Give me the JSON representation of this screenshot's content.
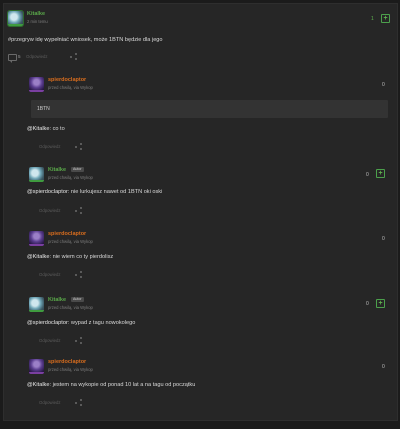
{
  "colors": {
    "background": "#1b1b1b",
    "card": "#262626",
    "op_name": "#5aa84a",
    "other_name": "#d86d1e",
    "plus_accent": "#4ca04c"
  },
  "post": {
    "author": "Kitalke",
    "meta": "2 min temu",
    "score": "1",
    "body": "#przegryw idę wypełniać wniosek, może 1BTN będzie dla jego",
    "comments_count": "5",
    "action_label": "Odpowiedz",
    "icons": [
      "comment-bubble-icon",
      "share-icon",
      "plus-icon"
    ]
  },
  "comments": [
    {
      "author": "spierdoclaptor",
      "meta": "przed chwilą, via Wykop",
      "score": "0",
      "embed": "1BTN",
      "text_mention": "@Kitalke",
      "text_rest": ": co to",
      "action_label": "Odpowiedz"
    },
    {
      "author": "Kitalke",
      "badge": "Autor",
      "meta": "przed chwilą, via Wykop",
      "score": "0",
      "text_mention": "@spierdoclaptor",
      "text_rest": ": nie lurkujesz nawet od 1BTN oki oski",
      "action_label": "Odpowiedz"
    },
    {
      "author": "spierdoclaptor",
      "meta": "przed chwilą, via Wykop",
      "score": "0",
      "text_mention": "@Kitalke",
      "text_rest": ": nie wiem co ty pierdolisz",
      "action_label": "Odpowiedz"
    },
    {
      "author": "Kitalke",
      "badge": "Autor",
      "meta": "przed chwilą, via Wykop",
      "score": "0",
      "text_mention": "@spierdoclaptor",
      "text_rest": ": wypad z tagu nowokolego",
      "action_label": "Odpowiedz"
    },
    {
      "author": "spierdoclaptor",
      "meta": "przed chwilą, via Wykop",
      "score": "0",
      "text_mention": "@Kitalke",
      "text_rest": ": jestem na wykopie od ponad 10 lat a na tagu od początku",
      "action_label": "Odpowiedz"
    }
  ]
}
